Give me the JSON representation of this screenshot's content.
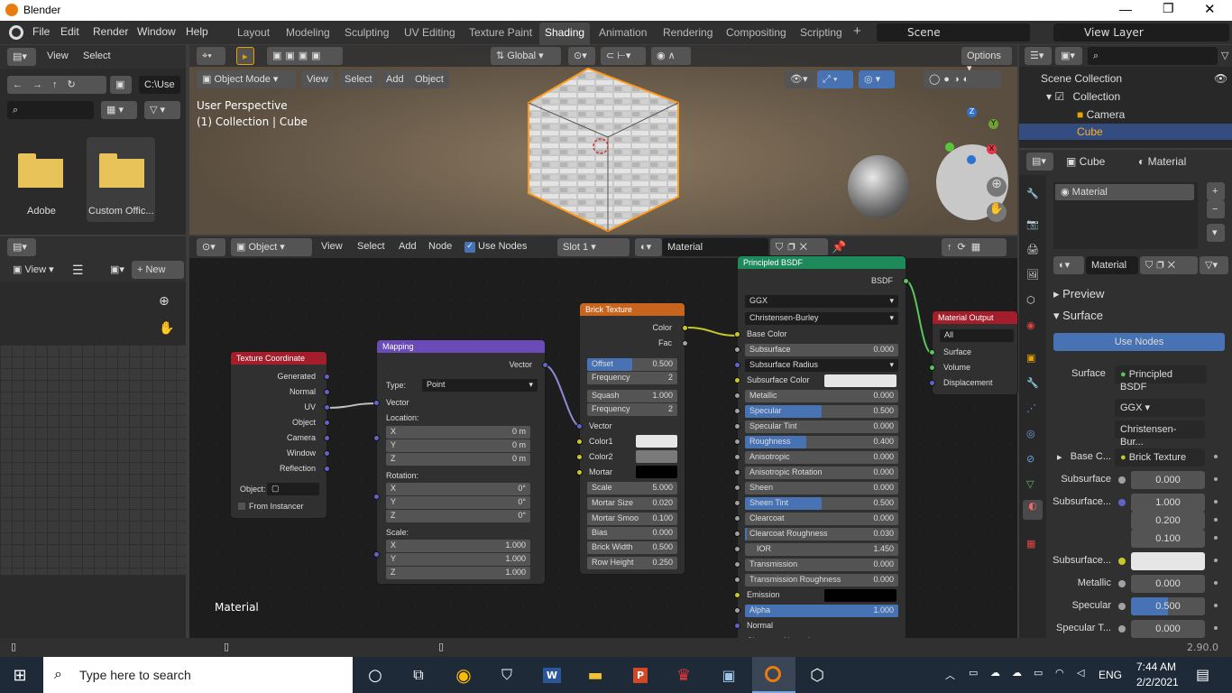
{
  "window": {
    "title": "Blender"
  },
  "menu": {
    "items": [
      "File",
      "Edit",
      "Render",
      "Window",
      "Help"
    ]
  },
  "workspaces": [
    "Layout",
    "Modeling",
    "Sculpting",
    "UV Editing",
    "Texture Paint",
    "Shading",
    "Animation",
    "Rendering",
    "Compositing",
    "Scripting"
  ],
  "active_workspace": "Shading",
  "scene": {
    "name": "Scene",
    "view_layer": "View Layer"
  },
  "file_browser": {
    "menu": [
      "View",
      "Select"
    ],
    "path": "C:\\Use",
    "folders": [
      "Adobe",
      "Custom Offic..."
    ]
  },
  "image_editor": {
    "menu": [
      "View"
    ],
    "new_label": "New"
  },
  "viewport": {
    "mode": "Object Mode",
    "menu": [
      "View",
      "Select",
      "Add",
      "Object"
    ],
    "transform": "Global",
    "options": "Options",
    "overlay_title": "User Perspective",
    "overlay_sub": "(1) Collection | Cube"
  },
  "node_editor": {
    "type": "Object",
    "menu": [
      "View",
      "Select",
      "Add",
      "Node"
    ],
    "use_nodes": "Use Nodes",
    "slot": "Slot 1",
    "material": "Material",
    "footer": "Material"
  },
  "nodes": {
    "texcoord": {
      "title": "Texture Coordinate",
      "outputs": [
        "Generated",
        "Normal",
        "UV",
        "Object",
        "Camera",
        "Window",
        "Reflection"
      ],
      "object_label": "Object:",
      "from_instancer": "From Instancer"
    },
    "mapping": {
      "title": "Mapping",
      "out": "Vector",
      "type_label": "Type:",
      "type_value": "Point",
      "vector": "Vector",
      "location": "Location:",
      "rotation": "Rotation:",
      "scale": "Scale:",
      "loc": [
        "0 m",
        "0 m",
        "0 m"
      ],
      "rot": [
        "0°",
        "0°",
        "0°"
      ],
      "scl": [
        "1.000",
        "1.000",
        "1.000"
      ],
      "axes": [
        "X",
        "Y",
        "Z"
      ]
    },
    "brick": {
      "title": "Brick Texture",
      "outputs": [
        "Color",
        "Fac"
      ],
      "offset": "Offset",
      "offset_v": "0.500",
      "freq": "Frequency",
      "freq_v": "2",
      "squash": "Squash",
      "squash_v": "1.000",
      "freq2_v": "2",
      "inputs": [
        "Vector",
        "Color1",
        "Color2",
        "Mortar"
      ],
      "scale": "Scale",
      "scale_v": "5.000",
      "mortar_size": "Mortar Size",
      "mortar_size_v": "0.020",
      "mortar_smooth": "Mortar Smoo",
      "mortar_smooth_v": "0.100",
      "bias": "Bias",
      "bias_v": "0.000",
      "brick_width": "Brick Width",
      "brick_width_v": "0.500",
      "row_height": "Row Height",
      "row_height_v": "0.250"
    },
    "bsdf": {
      "title": "Principled BSDF",
      "out": "BSDF",
      "dist": "GGX",
      "sss": "Christensen-Burley",
      "rows": [
        [
          "Base Color",
          ""
        ],
        [
          "Subsurface",
          "0.000"
        ],
        [
          "Subsurface Radius",
          ""
        ],
        [
          "Subsurface Color",
          ""
        ],
        [
          "Metallic",
          "0.000"
        ],
        [
          "Specular",
          "0.500"
        ],
        [
          "Specular Tint",
          "0.000"
        ],
        [
          "Roughness",
          "0.400"
        ],
        [
          "Anisotropic",
          "0.000"
        ],
        [
          "Anisotropic Rotation",
          "0.000"
        ],
        [
          "Sheen",
          "0.000"
        ],
        [
          "Sheen Tint",
          "0.500"
        ],
        [
          "Clearcoat",
          "0.000"
        ],
        [
          "Clearcoat Roughness",
          "0.030"
        ],
        [
          "IOR",
          "1.450"
        ],
        [
          "Transmission",
          "0.000"
        ],
        [
          "Transmission Roughness",
          "0.000"
        ],
        [
          "Emission",
          ""
        ],
        [
          "Alpha",
          "1.000"
        ],
        [
          "Normal",
          ""
        ],
        [
          "Clearcoat Normal",
          ""
        ]
      ]
    },
    "output": {
      "title": "Material Output",
      "target": "All",
      "inputs": [
        "Surface",
        "Volume",
        "Displacement"
      ]
    }
  },
  "outliner": {
    "root": "Scene Collection",
    "items": [
      "Collection",
      "Camera",
      "Cube"
    ]
  },
  "properties": {
    "object": "Cube",
    "material_tab": "Material",
    "slot": "Material",
    "mat_name": "Material",
    "preview": "Preview",
    "surface_panel": "Surface",
    "use_nodes": "Use Nodes",
    "surface_label": "Surface",
    "surface_value": "Principled BSDF",
    "dist": "GGX",
    "sss": "Christensen-Bur...",
    "rows": [
      [
        "Base C...",
        "Brick Texture"
      ],
      [
        "Subsurface",
        "0.000"
      ],
      [
        "Subsurface...",
        "1.000"
      ],
      [
        "",
        "0.200"
      ],
      [
        "",
        "0.100"
      ],
      [
        "Subsurface...",
        ""
      ],
      [
        "Metallic",
        "0.000"
      ],
      [
        "Specular",
        "0.500"
      ],
      [
        "Specular T...",
        "0.000"
      ]
    ],
    "version": "2.90.0"
  },
  "taskbar": {
    "search": "Type here to search",
    "time": "7:44 AM",
    "date": "2/2/2021",
    "lang": "ENG"
  }
}
